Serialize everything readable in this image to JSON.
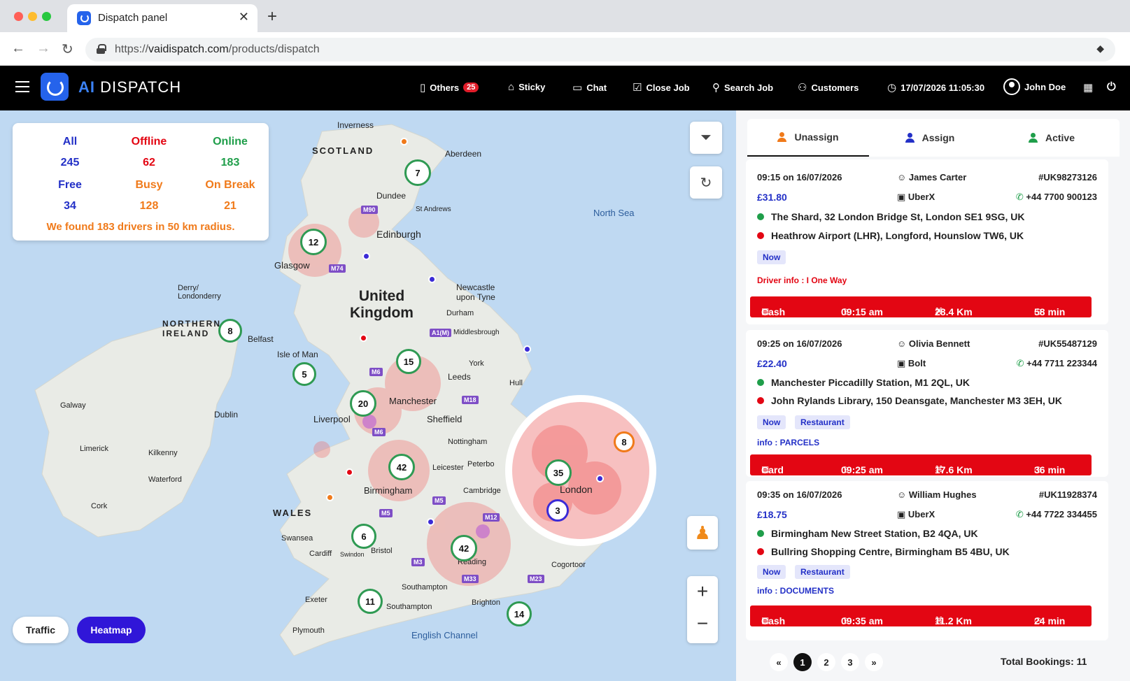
{
  "browser": {
    "tab_title": "Dispatch panel",
    "url_scheme": "https://",
    "url_host": "vaidispatch.com",
    "url_path": "/products/dispatch"
  },
  "header": {
    "logo_ai": "AI",
    "logo_text": "DISPATCH",
    "menu": {
      "others": "Others",
      "others_badge": "25",
      "sticky": "Sticky",
      "chat": "Chat",
      "close_job": "Close Job",
      "search_job": "Search Job",
      "customers": "Customers"
    },
    "datetime": "17/07/2026 11:05:30",
    "user": "John Doe"
  },
  "stats": {
    "all_label": "All",
    "all_value": "245",
    "offline_label": "Offline",
    "offline_value": "62",
    "online_label": "Online",
    "online_value": "183",
    "free_label": "Free",
    "free_value": "34",
    "busy_label": "Busy",
    "busy_value": "128",
    "onbreak_label": "On Break",
    "onbreak_value": "21",
    "message": "We found 183 drivers in 50 km radius."
  },
  "map": {
    "labels": {
      "inverness": "Inverness",
      "aberdeen": "Aberdeen",
      "scotland": "SCOTLAND",
      "dundee": "Dundee",
      "standrews": "St Andrews",
      "edinburgh": "Edinburgh",
      "glasgow": "Glasgow",
      "northsea": "North Sea",
      "derry": "Derry/\nLondonderry",
      "ni": "NORTHERN\nIRELAND",
      "belfast": "Belfast",
      "uk": "United\nKingdom",
      "newcastle": "Newcastle\nupon Tyne",
      "durham": "Durham",
      "middlesbrough": "Middlesbrough",
      "isleofman": "Isle of Man",
      "york": "York",
      "leeds": "Leeds",
      "hull": "Hull",
      "galway": "Galway",
      "dublin": "Dublin",
      "manchester": "Manchester",
      "liverpool": "Liverpool",
      "sheffield": "Sheffield",
      "nottingham": "Nottingham",
      "limerick": "Limerick",
      "kilkenny": "Kilkenny",
      "leicester": "Leicester",
      "peterborough": "Peterbo",
      "waterford": "Waterford",
      "birmingham": "Birmingham",
      "cambridge": "Cambridge",
      "london": "London",
      "cork": "Cork",
      "wales": "WALES",
      "swansea": "Swansea",
      "cardiff": "Cardiff",
      "bristol": "Bristol",
      "swindon": "Swindon",
      "reading": "Reading",
      "coggeshall": "Cogortoor",
      "southampton1": "Southampton",
      "southampton2": "Southampton",
      "exeter": "Exeter",
      "brighton": "Brighton",
      "plymouth": "Plymouth",
      "englishchannel": "English Channel"
    },
    "roads": {
      "m90": "M90",
      "m74": "M74",
      "a1m": "A1(M)",
      "m6a": "M6",
      "m6b": "M6",
      "m18": "M18",
      "m5a": "M5",
      "m5b": "M5",
      "m12": "M12",
      "m3": "M3",
      "m33": "M33",
      "m23": "M23"
    },
    "clusters": {
      "c7": "7",
      "c12": "12",
      "c8a": "8",
      "c5": "5",
      "c15": "15",
      "c20": "20",
      "c42a": "42",
      "c35": "35",
      "c8b": "8",
      "c3": "3",
      "c6": "6",
      "c42b": "42",
      "c11": "11",
      "c14": "14"
    },
    "traffic_label": "Traffic",
    "heatmap_label": "Heatmap"
  },
  "panel": {
    "tabs": {
      "unassign": "Unassign",
      "assign": "Assign",
      "active": "Active"
    },
    "bookings": [
      {
        "time": "09:15 on 16/07/2026",
        "name": "James Carter",
        "id": "#UK98273126",
        "price": "£31.80",
        "service": "UberX",
        "phone": "+44 7700 900123",
        "pickup": "The Shard, 32 London Bridge St, London SE1 9SG, UK",
        "dropoff": "Heathrow Airport (LHR), Longford, Hounslow TW6, UK",
        "tags": [
          "Now"
        ],
        "info": "Driver info : I One Way",
        "payment": "Cash",
        "eta": "09:15 am",
        "distance": "28.4 Km",
        "duration": "58 min"
      },
      {
        "time": "09:25 on 16/07/2026",
        "name": "Olivia Bennett",
        "id": "#UK55487129",
        "price": "£22.40",
        "service": "Bolt",
        "phone": "+44 7711 223344",
        "pickup": "Manchester Piccadilly Station, M1 2QL, UK",
        "dropoff": "John Rylands Library, 150 Deansgate, Manchester M3 3EH, UK",
        "tags": [
          "Now",
          "Restaurant"
        ],
        "info": "info : PARCELS",
        "payment": "Card",
        "eta": "09:25 am",
        "distance": "17.6 Km",
        "duration": "36 min"
      },
      {
        "time": "09:35 on 16/07/2026",
        "name": "William Hughes",
        "id": "#UK11928374",
        "price": "£18.75",
        "service": "UberX",
        "phone": "+44 7722 334455",
        "pickup": "Birmingham New Street Station, B2 4QA, UK",
        "dropoff": "Bullring Shopping Centre, Birmingham B5 4BU, UK",
        "tags": [
          "Now",
          "Restaurant"
        ],
        "info": "info : DOCUMENTS",
        "payment": "Cash",
        "eta": "09:35 am",
        "distance": "11.2 Km",
        "duration": "24 min"
      }
    ],
    "pager": {
      "first": "«",
      "p1": "1",
      "p2": "2",
      "p3": "3",
      "last": "»"
    },
    "total": "Total Bookings: 11"
  }
}
